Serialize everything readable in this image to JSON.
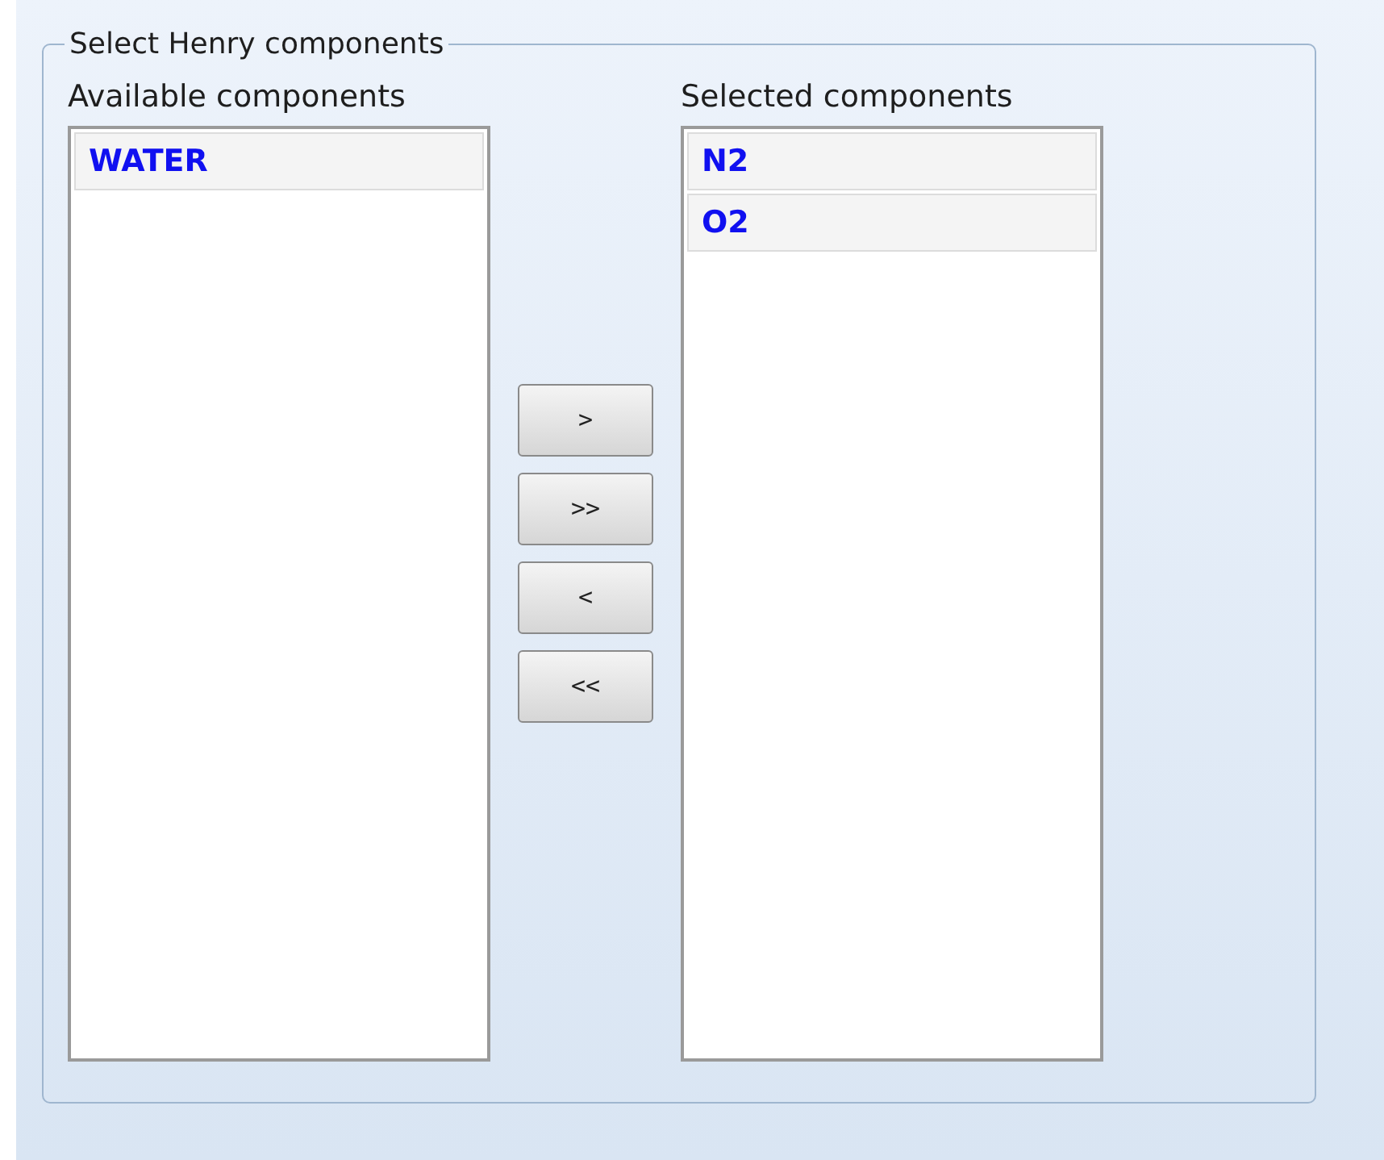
{
  "group": {
    "title": "Select Henry components"
  },
  "available": {
    "label": "Available components",
    "items": [
      "WATER"
    ]
  },
  "buttons": [
    ">",
    ">>",
    "<",
    "<<"
  ],
  "selected": {
    "label": "Selected components",
    "items": [
      "N2",
      "O2"
    ]
  }
}
